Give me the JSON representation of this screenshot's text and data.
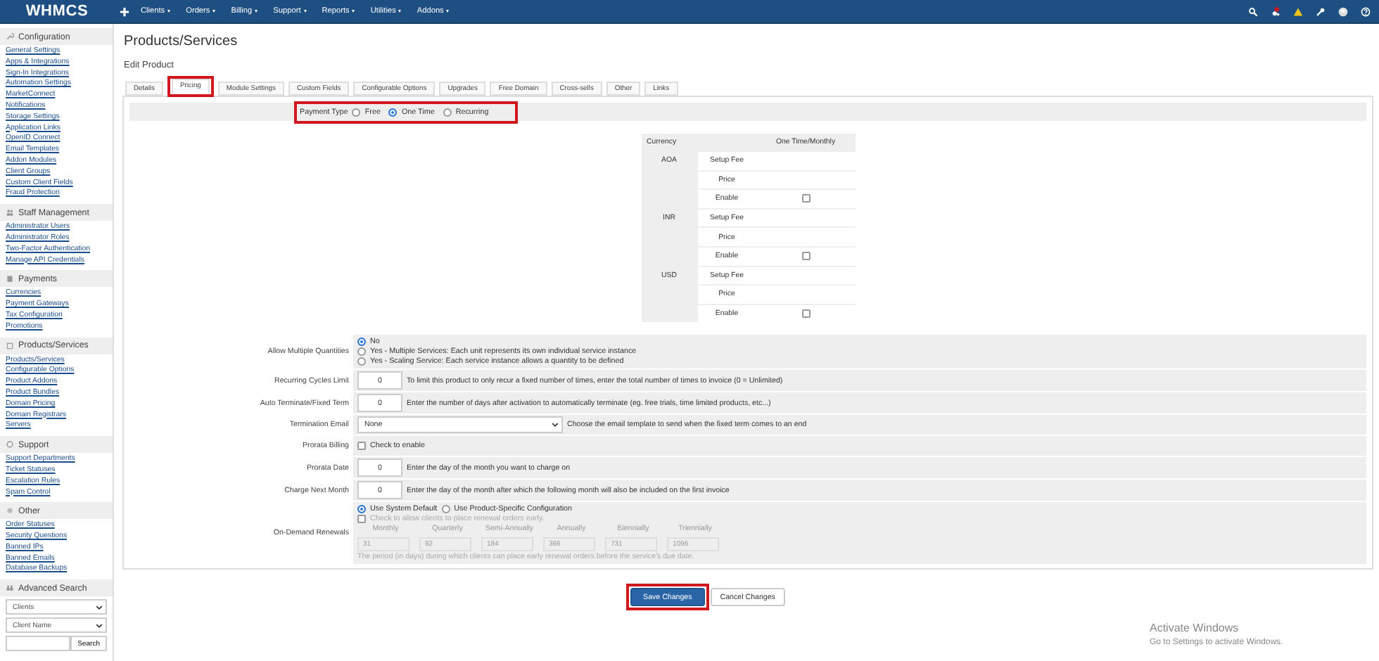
{
  "nav": {
    "logo": "WHMCS",
    "menu": [
      {
        "label": "Clients"
      },
      {
        "label": "Orders"
      },
      {
        "label": "Billing"
      },
      {
        "label": "Support"
      },
      {
        "label": "Reports"
      },
      {
        "label": "Utilities"
      },
      {
        "label": "Addons"
      }
    ]
  },
  "sidebar": {
    "sections": [
      {
        "kind": "config",
        "title": "Configuration",
        "items": [
          "General Settings",
          "Apps & Integrations",
          "Sign-In Integrations",
          "Automation Settings",
          "MarketConnect",
          "Notifications",
          "Storage Settings",
          "Application Links",
          "OpenID Connect",
          "Email Templates",
          "Addon Modules",
          "Client Groups",
          "Custom Client Fields",
          "Fraud Protection"
        ]
      },
      {
        "kind": "staff",
        "title": "Staff Management",
        "items": [
          "Administrator Users",
          "Administrator Roles",
          "Two-Factor Authentication",
          "Manage API Credentials"
        ]
      },
      {
        "kind": "payments",
        "title": "Payments",
        "items": [
          "Currencies",
          "Payment Gateways",
          "Tax Configuration",
          "Promotions"
        ]
      },
      {
        "kind": "products",
        "title": "Products/Services",
        "items": [
          "Products/Services",
          "Configurable Options",
          "Product Addons",
          "Product Bundles",
          "Domain Pricing",
          "Domain Registrars",
          "Servers"
        ]
      },
      {
        "kind": "support",
        "title": "Support",
        "items": [
          "Support Departments",
          "Ticket Statuses",
          "Escalation Rules",
          "Spam Control"
        ]
      },
      {
        "kind": "other",
        "title": "Other",
        "items": [
          "Order Statuses",
          "Security Questions",
          "Banned IPs",
          "Banned Emails",
          "Database Backups"
        ]
      }
    ],
    "advanced_search": {
      "title": "Advanced Search",
      "selects": [
        "Clients",
        "Client Name"
      ],
      "button": "Search"
    }
  },
  "page": {
    "title": "Products/Services",
    "subtitle": "Edit Product"
  },
  "tabs": [
    {
      "label": "Details",
      "selected": false,
      "highlighted": false
    },
    {
      "label": "Pricing",
      "selected": true,
      "highlighted": true
    },
    {
      "label": "Module Settings",
      "selected": false,
      "highlighted": false
    },
    {
      "label": "Custom Fields",
      "selected": false,
      "highlighted": false
    },
    {
      "label": "Configurable Options",
      "selected": false,
      "highlighted": false
    },
    {
      "label": "Upgrades",
      "selected": false,
      "highlighted": false
    },
    {
      "label": "Free Domain",
      "selected": false,
      "highlighted": false
    },
    {
      "label": "Cross-sells",
      "selected": false,
      "highlighted": false
    },
    {
      "label": "Other",
      "selected": false,
      "highlighted": false
    },
    {
      "label": "Links",
      "selected": false,
      "highlighted": false
    }
  ],
  "payment_type": {
    "label": "Payment Type",
    "highlighted": true,
    "options": [
      {
        "label": "Free",
        "selected": false
      },
      {
        "label": "One Time",
        "selected": true
      },
      {
        "label": "Recurring",
        "selected": false
      }
    ]
  },
  "pricing": {
    "columns": [
      "Currency",
      "One Time/Monthly"
    ],
    "currencies": [
      {
        "code": "AOA",
        "rows": [
          {
            "kind": "text",
            "label": "Setup Fee"
          },
          {
            "kind": "text",
            "label": "Price"
          },
          {
            "kind": "checkbox",
            "label": "Enable",
            "checked": false
          }
        ]
      },
      {
        "code": "INR",
        "rows": [
          {
            "kind": "text",
            "label": "Setup Fee"
          },
          {
            "kind": "text",
            "label": "Price"
          },
          {
            "kind": "checkbox",
            "label": "Enable",
            "checked": false
          }
        ]
      },
      {
        "code": "USD",
        "rows": [
          {
            "kind": "text",
            "label": "Setup Fee"
          },
          {
            "kind": "text",
            "label": "Price"
          },
          {
            "kind": "checkbox",
            "label": "Enable",
            "checked": false
          }
        ]
      }
    ]
  },
  "fields": [
    {
      "kind": "radios",
      "label": "Allow Multiple Quantities",
      "options": [
        {
          "label": "No",
          "selected": true
        },
        {
          "label": "Yes - Multiple Services: Each unit represents its own individual service instance",
          "selected": false
        },
        {
          "label": "Yes - Scaling Service: Each service instance allows a quantity to be defined",
          "selected": false
        }
      ]
    },
    {
      "kind": "number",
      "label": "Recurring Cycles Limit",
      "value": "0",
      "help": "To limit this product to only recur a fixed number of times, enter the total number of times to invoice (0 = Unlimited)"
    },
    {
      "kind": "number",
      "label": "Auto Terminate/Fixed Term",
      "value": "0",
      "help": "Enter the number of days after activation to automatically terminate (eg. free trials, time limited products, etc...)"
    },
    {
      "kind": "select",
      "label": "Termination Email",
      "value": "None",
      "help": "Choose the email template to send when the fixed term comes to an end"
    },
    {
      "kind": "checkbox",
      "label": "Prorata Billing",
      "checked": false,
      "help": "Check to enable"
    },
    {
      "kind": "number",
      "label": "Prorata Date",
      "value": "0",
      "help": "Enter the day of the month you want to charge on"
    },
    {
      "kind": "number",
      "label": "Charge Next Month",
      "value": "0",
      "help": "Enter the day of the month after which the following month will also be included on the first invoice"
    },
    {
      "kind": "renewals",
      "label": "On-Demand Renewals",
      "options": [
        {
          "label": "Use System Default",
          "selected": true
        },
        {
          "label": "Use Product-Specific Configuration",
          "selected": false
        }
      ],
      "early": {
        "label": "Check to allow clients to place renewal orders early.",
        "checked": false
      },
      "disabled": true,
      "periods": [
        {
          "label": "Monthly",
          "value": "31"
        },
        {
          "label": "Quarterly",
          "value": "92"
        },
        {
          "label": "Semi-Annually",
          "value": "184"
        },
        {
          "label": "Annually",
          "value": "366"
        },
        {
          "label": "Biennially",
          "value": "731"
        },
        {
          "label": "Triennially",
          "value": "1096"
        }
      ],
      "note": "The period (in days) during which clients can place early renewal orders before the service's due date."
    }
  ],
  "actions": [
    {
      "kind": "primary",
      "label": "Save Changes",
      "highlighted": true
    },
    {
      "kind": "default",
      "label": "Cancel Changes",
      "highlighted": false
    }
  ],
  "os_notice": {
    "title": "Activate Windows",
    "text": "Go to Settings to activate Windows."
  }
}
